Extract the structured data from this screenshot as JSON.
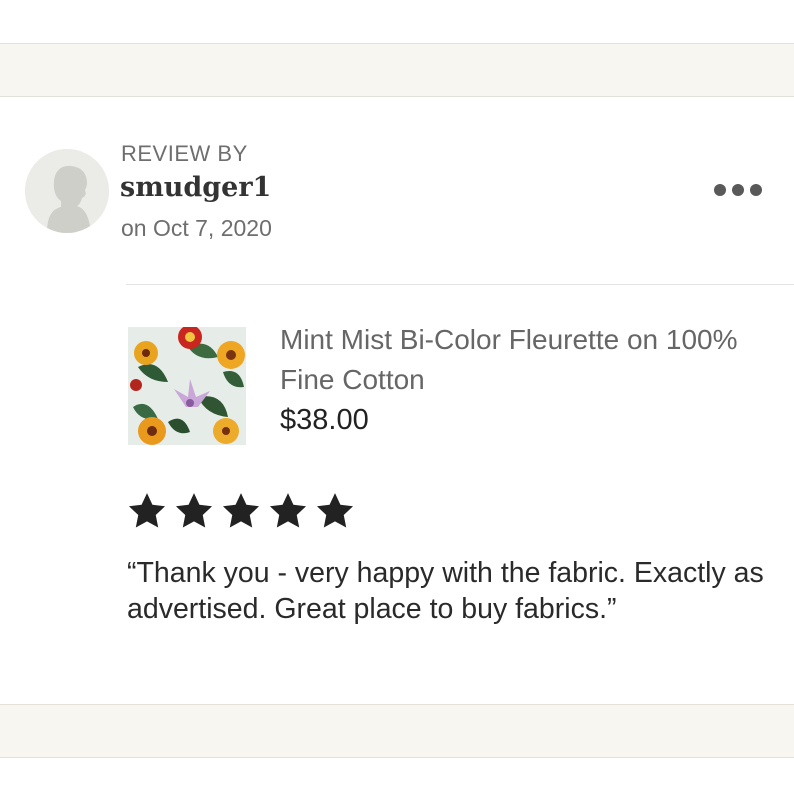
{
  "review": {
    "heading": "REVIEW BY",
    "username": "smudger1",
    "date": "on Oct 7, 2020",
    "rating": 5,
    "max_rating": 5,
    "text": "“Thank you - very happy with the fabric. Exactly as advertised. Great place to buy fabrics.”"
  },
  "product": {
    "title": "Mint Mist Bi-Color Fleurette on 100% Fine Cotton",
    "price": "$38.00"
  },
  "icons": {
    "avatar": "user-silhouette-icon",
    "more": "more-horizontal-icon",
    "star": "star-icon"
  },
  "colors": {
    "star": "#222222",
    "band": "#f8f6f1",
    "muted_text": "#6e6e6e"
  }
}
